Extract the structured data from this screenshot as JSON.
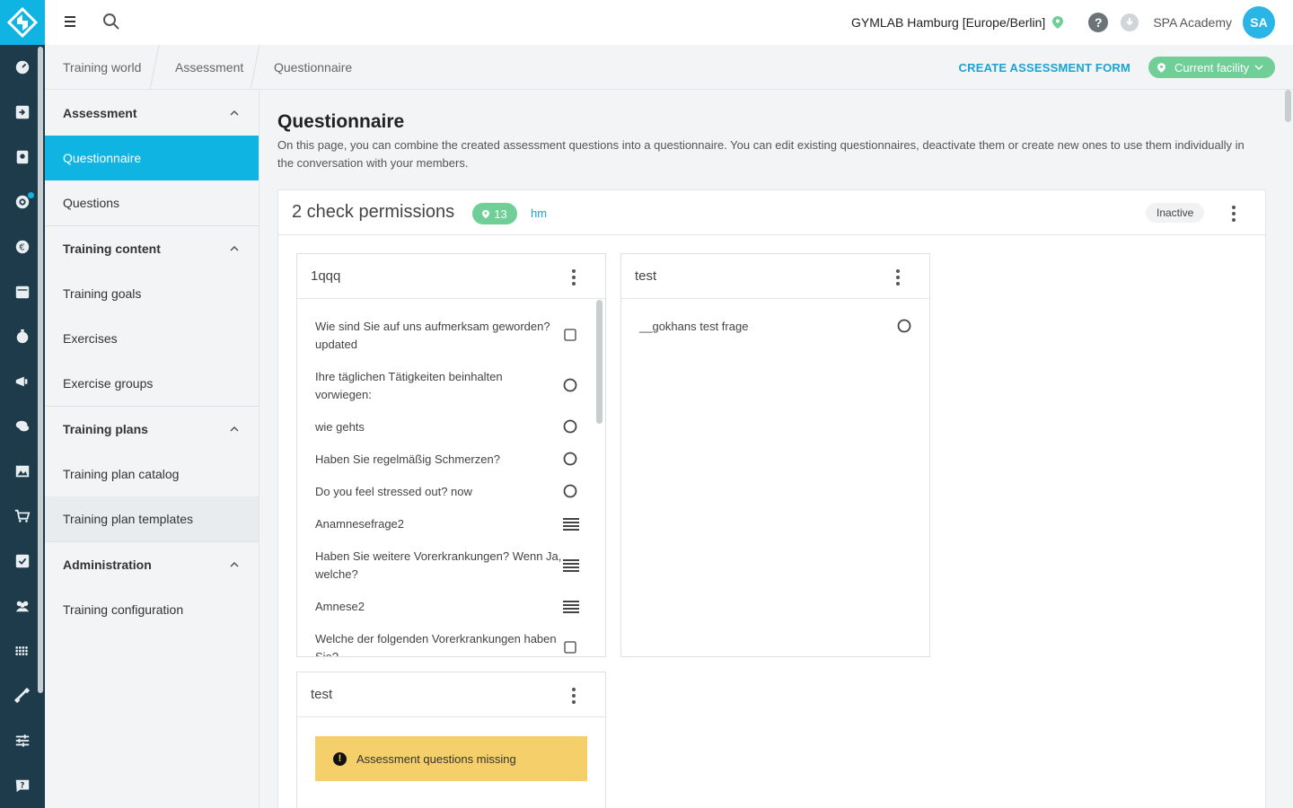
{
  "topbar": {
    "facility": "GYMLAB Hamburg [Europe/Berlin]",
    "account": "SPA Academy",
    "avatar_initials": "SA"
  },
  "breadcrumb": [
    "Training world",
    "Assessment",
    "Questionnaire"
  ],
  "actions": {
    "create_label": "CREATE ASSESSMENT FORM",
    "facility_filter": "Current facility"
  },
  "sidebar": {
    "sections": [
      {
        "title": "Assessment",
        "items": [
          "Questionnaire",
          "Questions"
        ]
      },
      {
        "title": "Training content",
        "items": [
          "Training goals",
          "Exercises",
          "Exercise groups"
        ]
      },
      {
        "title": "Training plans",
        "items": [
          "Training plan catalog",
          "Training plan templates"
        ]
      },
      {
        "title": "Administration",
        "items": [
          "Training configuration"
        ]
      }
    ],
    "active": "Questionnaire"
  },
  "page": {
    "title": "Questionnaire",
    "description": "On this page, you can combine the created assessment questions into a questionnaire. You can edit existing questionnaires, deactivate them or create new ones to use them individually in the conversation with your members."
  },
  "questionnaire": {
    "title": "2 check permissions",
    "facility_count": "13",
    "author": "hm",
    "status": "Inactive",
    "cards": [
      {
        "title": "1qqq",
        "questions": [
          {
            "text": "Wie sind Sie auf uns aufmerksam geworden? updated",
            "type": "checkbox-icon"
          },
          {
            "text": "Ihre täglichen Tätigkeiten beinhalten vorwiegen:",
            "type": "radio-icon"
          },
          {
            "text": "wie gehts",
            "type": "radio-icon"
          },
          {
            "text": "Haben Sie regelmäßig Schmerzen?",
            "type": "radio-icon"
          },
          {
            "text": "Do you feel stressed out? now",
            "type": "radio-icon"
          },
          {
            "text": "Anamnesefrage2",
            "type": "text-lines-icon"
          },
          {
            "text": "Haben Sie weitere Vorerkrankungen? Wenn Ja, welche?",
            "type": "text-lines-icon"
          },
          {
            "text": "Amnese2",
            "type": "text-lines-icon"
          },
          {
            "text": "Welche der folgenden Vorerkrankungen haben Sie?",
            "type": "checkbox-icon"
          }
        ]
      },
      {
        "title": "test",
        "questions": [
          {
            "text": "__gokhans test frage",
            "type": "radio-icon"
          }
        ]
      },
      {
        "title": "test",
        "warning": "Assessment questions missing"
      }
    ]
  },
  "colors": {
    "accent": "#0fb4e3",
    "rail": "#1e3b4b",
    "success": "#6fcf97",
    "warning": "#f5cf6a"
  }
}
